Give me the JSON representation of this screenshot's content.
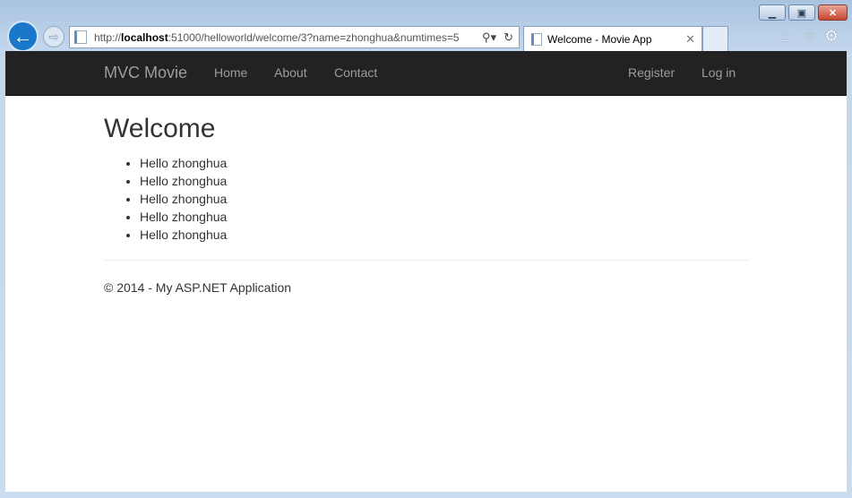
{
  "browser": {
    "url_prefix": "http://",
    "url_host": "localhost",
    "url_rest": ":51000/helloworld/welcome/3?name=zhonghua&numtimes=5",
    "tab_title": "Welcome - Movie App",
    "icons": [
      "back-icon",
      "forward-icon",
      "search-icon",
      "refresh-icon",
      "home-icon",
      "favorites-star-icon",
      "settings-gear-icon"
    ]
  },
  "nav": {
    "brand": "MVC Movie",
    "items": [
      "Home",
      "About",
      "Contact"
    ],
    "right": [
      "Register",
      "Log in"
    ]
  },
  "main": {
    "title": "Welcome",
    "items": [
      "Hello zhonghua",
      "Hello zhonghua",
      "Hello zhonghua",
      "Hello zhonghua",
      "Hello zhonghua"
    ]
  },
  "footer": {
    "text": "© 2014 - My ASP.NET Application"
  }
}
